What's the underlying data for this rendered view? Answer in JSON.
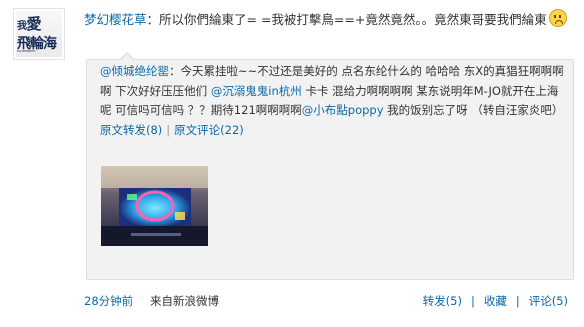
{
  "avatar": {
    "line1_small": "我",
    "line1_big": "愛",
    "line2": "飛輪海",
    "line3": "FAHRENHEIT"
  },
  "post": {
    "author": "梦幻樱花草",
    "text": "：所以你們綸東了= =我被打擊鳥==+竟然竟然。。竟然東哥要我們綸東",
    "emoji": "sad-face"
  },
  "quote": {
    "author": "@倾城绝纶罂",
    "text_1": "：今天累挂啦~~不过还是美好的  点名东纶什么的  哈哈哈  东X的真猖狂啊啊啊啊  下次好好压压他们 ",
    "mention_1": "@沉溺鬼鬼in杭州",
    "text_2": " 卡卡  混给力啊啊啊啊  某东说明年M-JO就开在上海呢  可信吗可信吗  ？？期待121啊啊啊啊",
    "mention_2": "@小布點poppy",
    "text_3": " 我的饭别忘了呀 （转自汪家炎吧）",
    "repost_link": "原文转发(8)",
    "comment_link": "原文评论(22)",
    "separator": "|"
  },
  "footer": {
    "time": "28分钟前",
    "source": "来自新浪微博",
    "repost": "转发(5)",
    "favorite": "收藏",
    "comment": "评论(5)",
    "divider": "|"
  },
  "colors": {
    "link": "#0a6aa9",
    "quote_bg": "#f2f2f2"
  }
}
